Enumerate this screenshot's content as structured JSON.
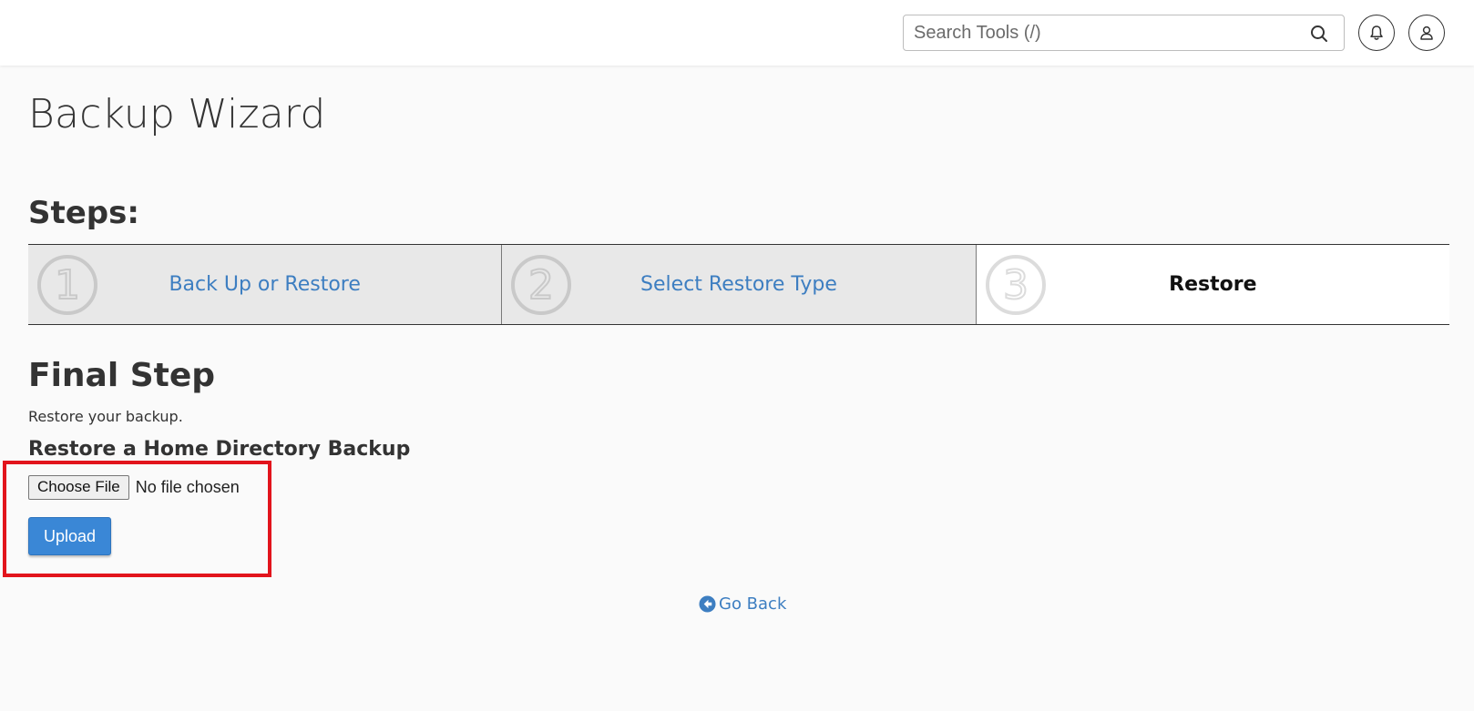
{
  "header": {
    "search_placeholder": "Search Tools (/)",
    "icons": [
      "search-icon",
      "bell-icon",
      "user-icon"
    ]
  },
  "page": {
    "title": "Backup Wizard"
  },
  "steps": {
    "heading": "Steps:",
    "items": [
      {
        "number": "1",
        "label": "Back Up or Restore",
        "active": false
      },
      {
        "number": "2",
        "label": "Select Restore Type",
        "active": false
      },
      {
        "number": "3",
        "label": "Restore",
        "active": true
      }
    ]
  },
  "final_step": {
    "heading": "Final Step",
    "description": "Restore your backup.",
    "subheading": "Restore a Home Directory Backup",
    "choose_file_label": "Choose File",
    "file_status": "No file chosen",
    "upload_label": "Upload"
  },
  "go_back": {
    "label": "Go Back",
    "icon": "arrow-circle-left-icon"
  },
  "colors": {
    "link": "#3d7ec1",
    "primary_button": "#3a87d6",
    "highlight": "#e2141c",
    "step_inactive_bg": "#e8e8e8"
  }
}
